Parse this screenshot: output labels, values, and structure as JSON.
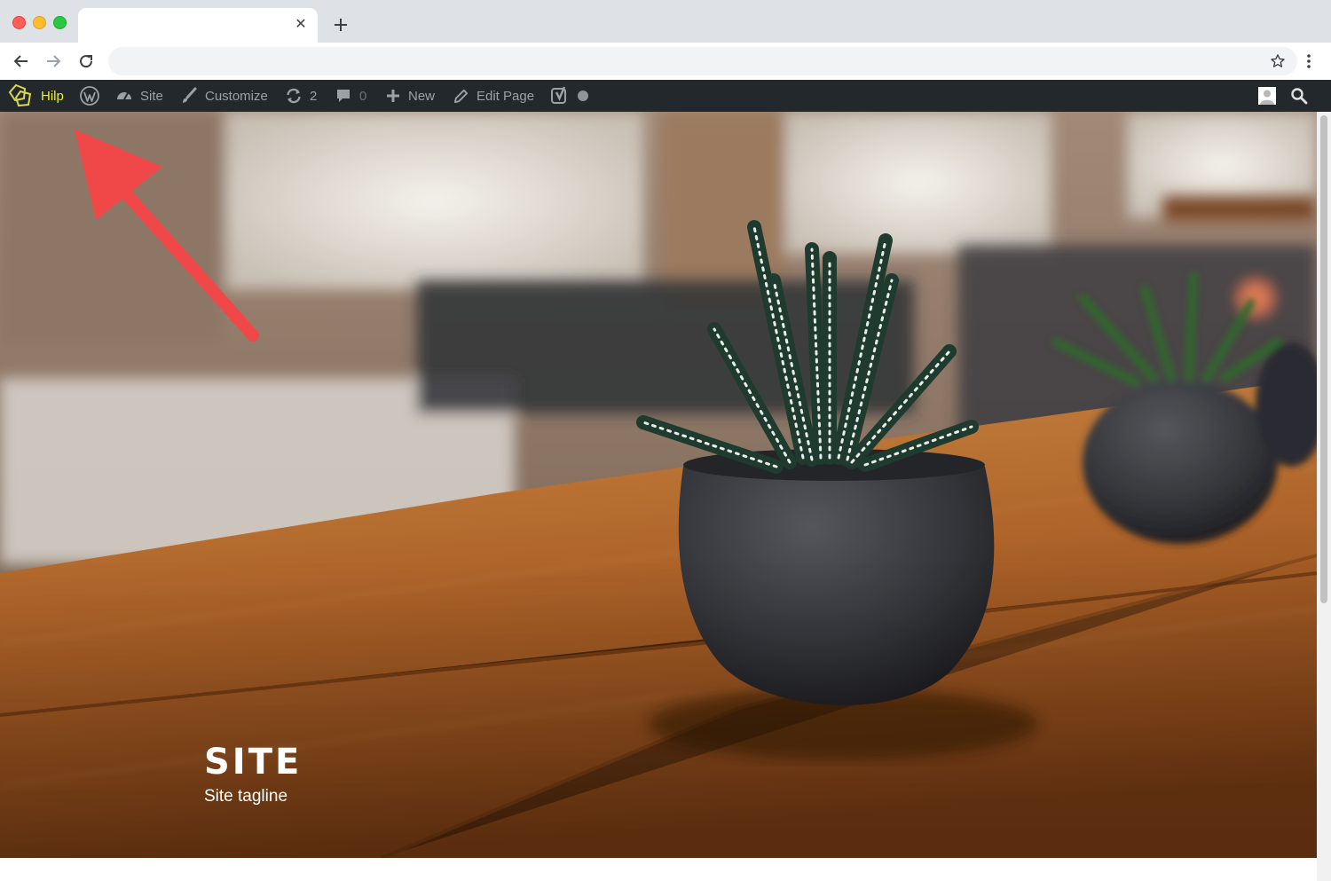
{
  "browser": {
    "tab_title": "",
    "tab_close_icon": "close-icon",
    "new_tab_icon": "plus-icon",
    "address": "",
    "icons": [
      "back-arrow-icon",
      "forward-arrow-icon",
      "reload-icon",
      "star-icon",
      "kebab-menu-icon"
    ]
  },
  "adminbar": {
    "hilp_label": "Hilp",
    "site_label": "Site",
    "customize_label": "Customize",
    "updates_count": "2",
    "comments_count": "0",
    "new_label": "New",
    "edit_page_label": "Edit Page",
    "colors": {
      "background": "#23282d",
      "text": "#9ca1a6",
      "accent": "#eeee22"
    }
  },
  "hero": {
    "title": "SITE",
    "tagline": "Site tagline"
  },
  "annotation": {
    "arrow_color": "#f04848"
  }
}
